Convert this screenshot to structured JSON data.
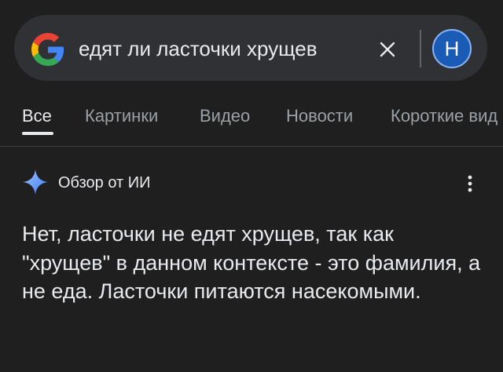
{
  "search": {
    "query": "едят ли ласточки хрущев",
    "avatar_letter": "Н"
  },
  "tabs": [
    {
      "label": "Все",
      "active": true
    },
    {
      "label": "Картинки",
      "active": false
    },
    {
      "label": "Видео",
      "active": false
    },
    {
      "label": "Новости",
      "active": false
    },
    {
      "label": "Короткие вид",
      "active": false
    }
  ],
  "ai_overview": {
    "title": "Обзор от ИИ",
    "answer": "Нет, ласточки не едят хрущев, так как \"хрущев\" в данном контексте - это фамилия, а не еда. Ласточки питаются насекомыми."
  },
  "icons": {
    "logo": "google-g-icon",
    "clear": "close-icon",
    "ai": "sparkle-icon",
    "more": "more-vert-icon"
  },
  "colors": {
    "background": "#1f1f1f",
    "search_bar": "#303134",
    "text_primary": "#e8eaed",
    "text_secondary": "#9aa0a6",
    "avatar_bg": "#1a5bb5",
    "ai_accent": "#4c8df6"
  }
}
